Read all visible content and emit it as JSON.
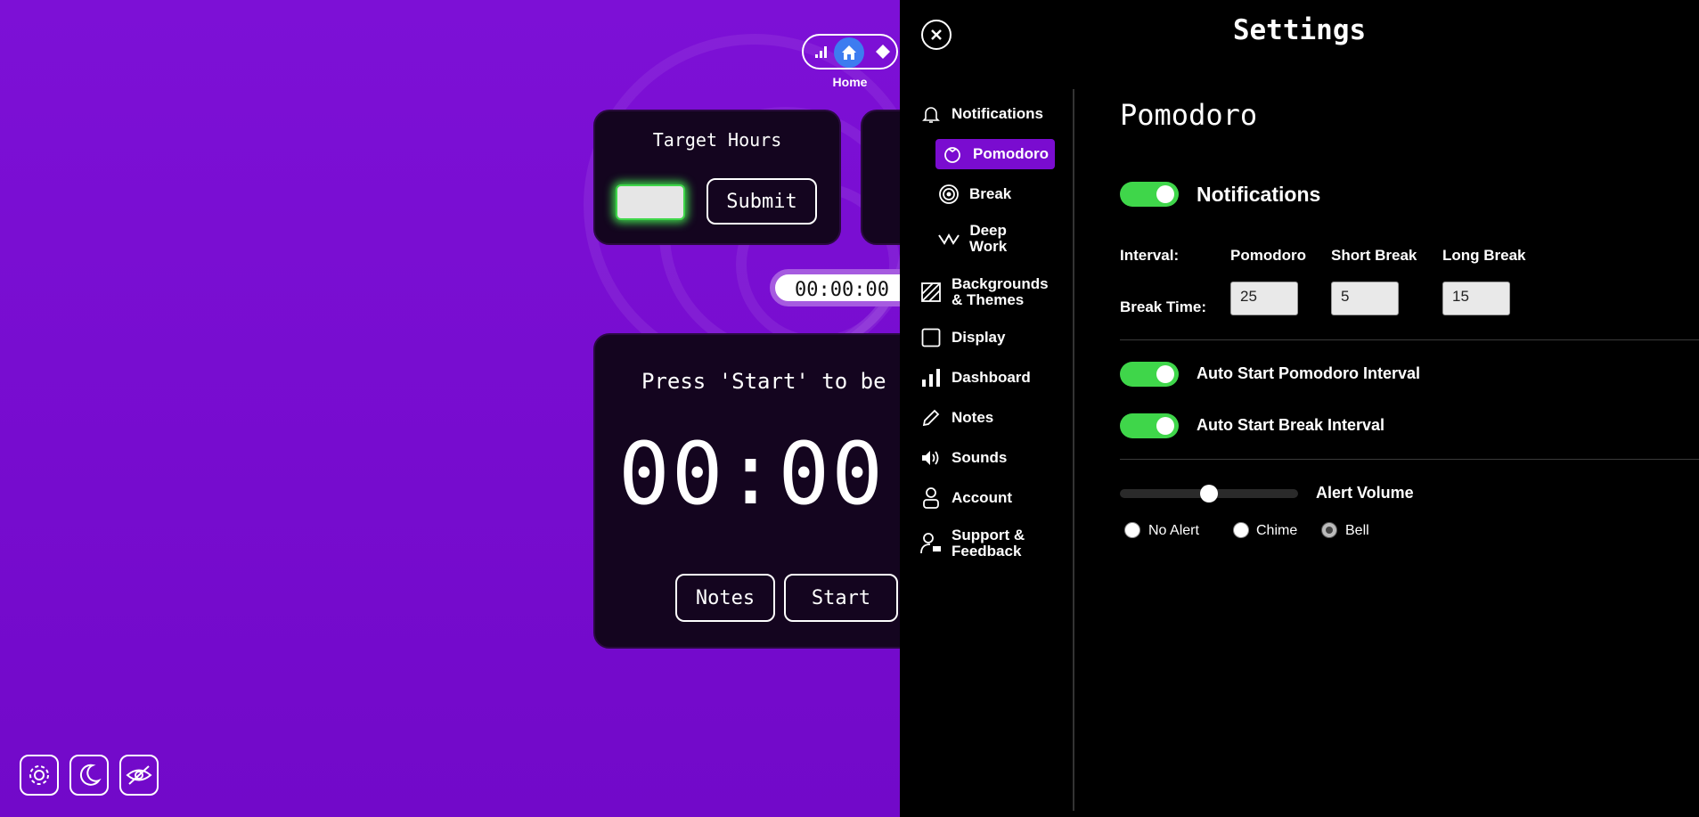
{
  "nav": {
    "label": "Home"
  },
  "target_hours": {
    "title": "Target Hours",
    "input_value": "",
    "submit_label": "Submit"
  },
  "timer": {
    "small_display": "00:00:00",
    "prompt": "Press 'Start' to be",
    "big_display": "00:00",
    "notes_label": "Notes",
    "start_label": "Start"
  },
  "settings": {
    "title": "Settings",
    "sidebar": {
      "notifications": "Notifications",
      "pomodoro": "Pomodoro",
      "break": "Break",
      "deep_work_1": "Deep",
      "deep_work_2": "Work",
      "backgrounds_1": "Backgrounds",
      "backgrounds_2": "& Themes",
      "display": "Display",
      "dashboard": "Dashboard",
      "notes": "Notes",
      "sounds": "Sounds",
      "account": "Account",
      "support_1": "Support &",
      "support_2": "Feedback"
    },
    "panel": {
      "heading": "Pomodoro",
      "notifications_label": "Notifications",
      "notifications_on": true,
      "interval_label": "Interval:",
      "break_time_label": "Break Time:",
      "col_pomodoro": "Pomodoro",
      "col_short_break": "Short Break",
      "col_long_break": "Long Break",
      "pomodoro_value": "25",
      "short_break_value": "5",
      "long_break_value": "15",
      "auto_start_pomodoro": "Auto Start Pomodoro Interval",
      "auto_start_break": "Auto Start Break Interval",
      "alert_volume_label": "Alert Volume",
      "alert_volume": 0.5,
      "alert_options": [
        "No Alert",
        "Chime",
        "Bell"
      ],
      "alert_selected": "Bell"
    }
  },
  "colors": {
    "accent": "#7a0cd0",
    "toggle_on": "#3fd64a",
    "home_icon_bg": "#3d7cf0",
    "input_glow": "#3fd64a"
  }
}
